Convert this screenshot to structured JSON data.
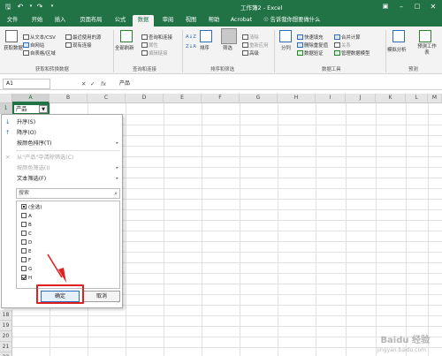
{
  "app": {
    "title": "工作簿2 - Excel"
  },
  "colors": {
    "accent": "#217346",
    "highlight": "#e02020",
    "info": "#2f6db5"
  },
  "quick_access": [
    "save-icon",
    "undo-icon",
    "redo-icon",
    "customize-icon"
  ],
  "window_controls": [
    "ribbon-display-icon",
    "minimize-icon",
    "restore-icon",
    "close-icon"
  ],
  "tabs": [
    {
      "label": "文件"
    },
    {
      "label": "开始"
    },
    {
      "label": "插入"
    },
    {
      "label": "页面布局"
    },
    {
      "label": "公式"
    },
    {
      "label": "数据",
      "active": true
    },
    {
      "label": "审阅"
    },
    {
      "label": "视图"
    },
    {
      "label": "帮助"
    },
    {
      "label": "Acrobat"
    }
  ],
  "tell_me": "告诉我你想要做什么",
  "ribbon": {
    "get_data": "获取数据",
    "from_text_csv": "从文本/CSV",
    "from_web": "自网站",
    "from_table": "自表格/区域",
    "recent_sources": "最近使用的源",
    "existing_connections": "现有连接",
    "refresh_all": "全部刷新",
    "queries_connections": "查询和连接",
    "properties": "属性",
    "edit_links": "编辑链接",
    "sort": "排序",
    "filter": "筛选",
    "clear": "清除",
    "reapply": "重新应用",
    "advanced": "高级",
    "text_to_columns": "分列",
    "flash_fill": "快速填充",
    "remove_duplicates": "删除重复值",
    "data_validation": "数据验证",
    "consolidate": "合并计算",
    "relationships": "关系",
    "manage_data_model": "管理数据模型",
    "what_if": "模拟分析",
    "forecast_sheet": "预测工作表",
    "groups": {
      "get_transform": "获取和转换数据",
      "queries": "查询和连接",
      "sort_filter": "排序和筛选",
      "data_tools": "数据工具",
      "forecast": "预测"
    }
  },
  "formula_bar": {
    "name_box": "A1",
    "fx": "fx",
    "content": "产品"
  },
  "columns": [
    "A",
    "B",
    "C",
    "D",
    "E",
    "F",
    "G",
    "H",
    "I",
    "J",
    "K",
    "L",
    "M"
  ],
  "rows": [
    "1",
    "18",
    "19",
    "20",
    "21",
    "22"
  ],
  "cell_a1": "产品",
  "menu": {
    "items": {
      "sort_asc": "升序(S)",
      "sort_desc": "降序(O)",
      "sort_by_color": "按颜色排序(T)",
      "clear_filter": "从\"产品\"中清除筛选(C)",
      "filter_by_color": "按颜色筛选(I)",
      "text_filters": "文本筛选(F)"
    },
    "search_placeholder": "搜索",
    "list": [
      {
        "label": "(全选)",
        "state": "mixed"
      },
      {
        "label": "A",
        "state": "unchecked"
      },
      {
        "label": "B",
        "state": "unchecked"
      },
      {
        "label": "C",
        "state": "unchecked"
      },
      {
        "label": "D",
        "state": "unchecked"
      },
      {
        "label": "E",
        "state": "unchecked"
      },
      {
        "label": "F",
        "state": "unchecked"
      },
      {
        "label": "G",
        "state": "unchecked"
      },
      {
        "label": "H",
        "state": "checked"
      }
    ],
    "ok": "确定",
    "cancel": "取消"
  },
  "watermark": {
    "main": "Baidu 经验",
    "sub": "jingyan.baidu.com"
  }
}
